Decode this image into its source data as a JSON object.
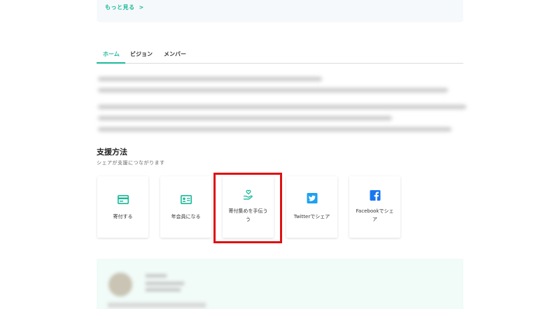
{
  "top": {
    "more_link": "もっと見る",
    "more_chevron": ">"
  },
  "tabs": [
    {
      "label": "ホーム",
      "active": true
    },
    {
      "label": "ビジョン",
      "active": false
    },
    {
      "label": "メンバー",
      "active": false
    }
  ],
  "support": {
    "title": "支援方法",
    "subtitle": "シェアが支援につながります",
    "options": [
      {
        "label": "寄付する",
        "icon": "credit-card-icon"
      },
      {
        "label": "年会員になる",
        "icon": "member-card-icon"
      },
      {
        "label": "寄付集めを手伝う",
        "label_line2": "う",
        "icon": "hand-heart-icon"
      },
      {
        "label": "Twitterでシェア",
        "icon": "twitter-icon"
      },
      {
        "label": "Facebookでシェ",
        "label_line2": "ア",
        "icon": "facebook-icon"
      }
    ]
  },
  "colors": {
    "accent": "#1bb99a",
    "twitter": "#1da1f2",
    "facebook": "#1877f2",
    "highlight": "#e01010"
  }
}
